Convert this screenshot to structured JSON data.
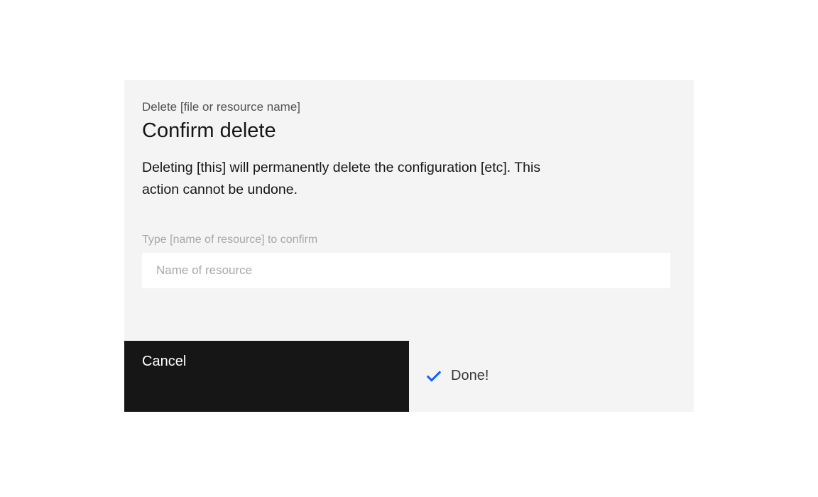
{
  "modal": {
    "eyebrow": "Delete [file or resource name]",
    "title": "Confirm delete",
    "description": "Deleting [this] will permanently delete the configuration [etc]. This action cannot be undone.",
    "confirm_field": {
      "label": "Type [name of resource] to confirm",
      "placeholder": "Name of resource",
      "value": ""
    },
    "footer": {
      "cancel_label": "Cancel",
      "done_label": "Done!"
    }
  }
}
